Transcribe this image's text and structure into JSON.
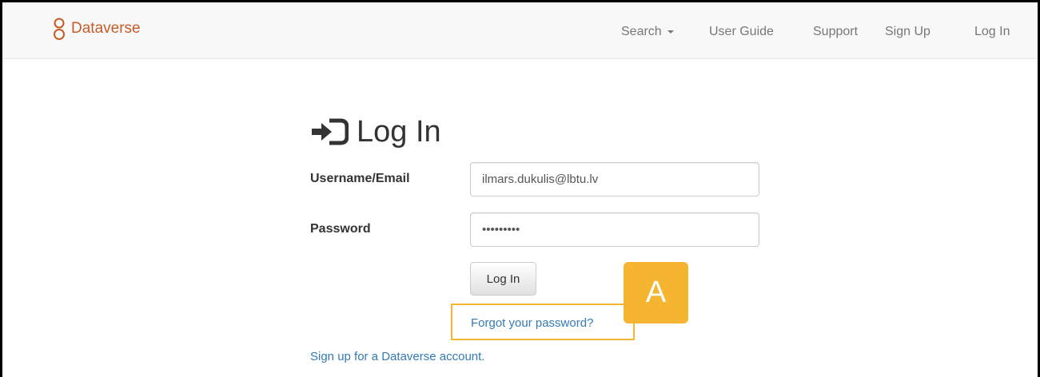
{
  "brand": {
    "name": "Dataverse",
    "icon": "dataverse-logo-icon",
    "color": "#c55b28"
  },
  "navbar": {
    "search_label": "Search",
    "user_guide": "User Guide",
    "support": "Support",
    "sign_up": "Sign Up",
    "log_in": "Log In"
  },
  "page": {
    "title": "Log In",
    "title_icon": "log-in-icon"
  },
  "form": {
    "username_label": "Username/Email",
    "username_value": "ilmars.dukulis@lbtu.lv",
    "password_label": "Password",
    "password_value": "•••••••••",
    "submit_label": "Log In",
    "forgot_link": "Forgot your password?",
    "signup_link": "Sign up for a Dataverse account."
  },
  "annotation": {
    "badge_letter": "A",
    "color": "#f5b530"
  }
}
